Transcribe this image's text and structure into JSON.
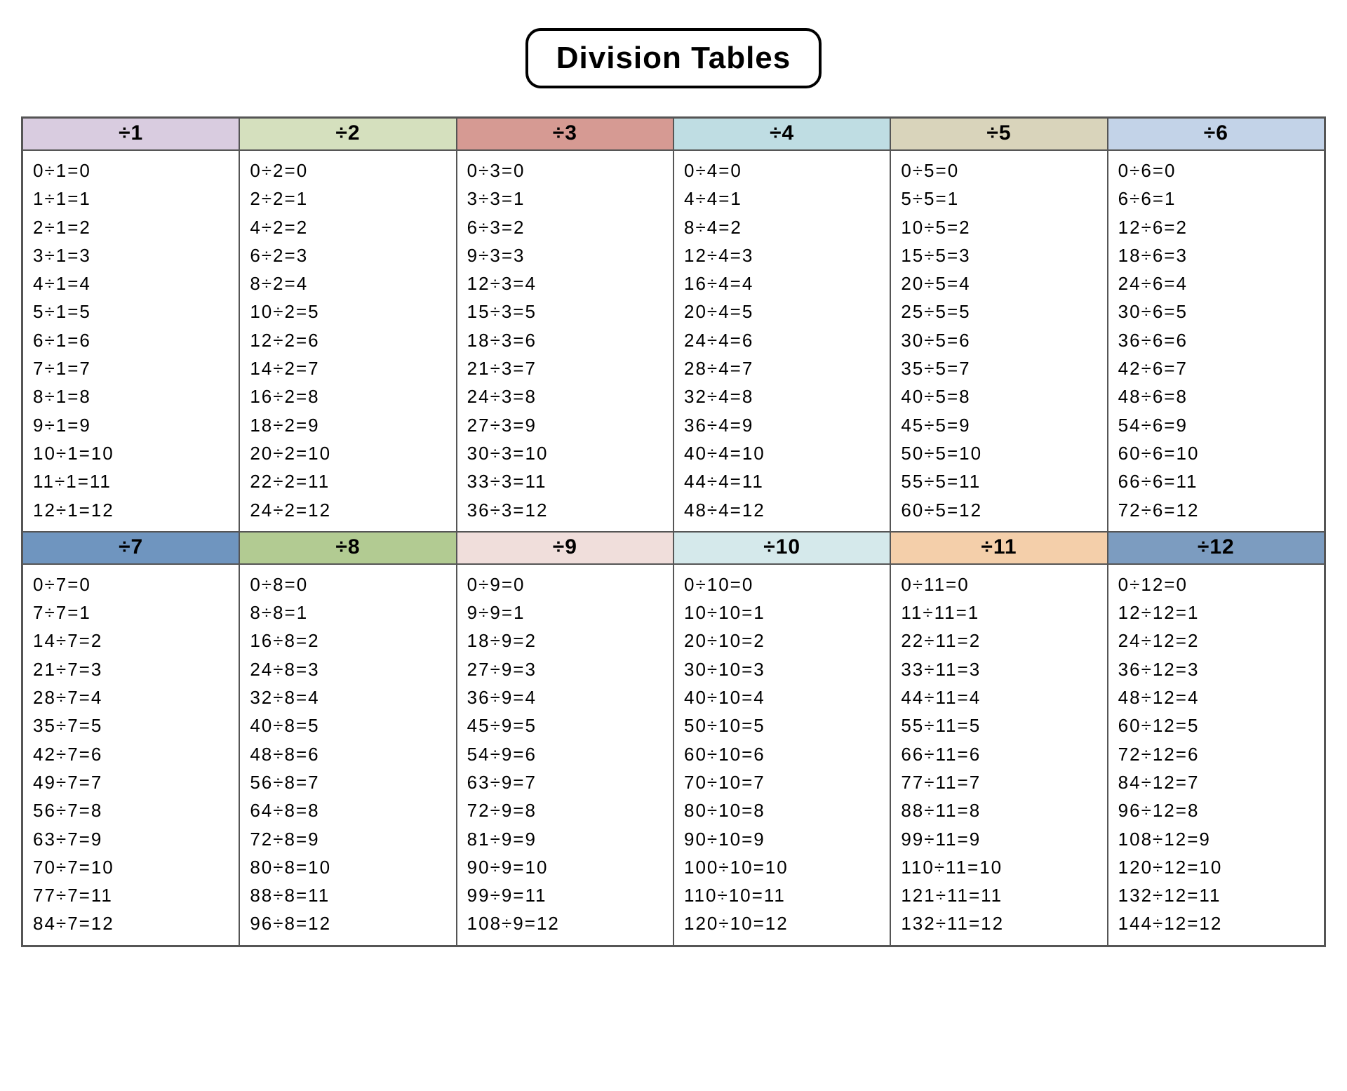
{
  "title": "Division Tables",
  "columns": [
    {
      "header": "÷1",
      "color": "#d9cce0",
      "divisor": 1
    },
    {
      "header": "÷2",
      "color": "#d5e0be",
      "divisor": 2
    },
    {
      "header": "÷3",
      "color": "#d69a93",
      "divisor": 3
    },
    {
      "header": "÷4",
      "color": "#bfdde3",
      "divisor": 4
    },
    {
      "header": "÷5",
      "color": "#d9d4bb",
      "divisor": 5
    },
    {
      "header": "÷6",
      "color": "#c3d3e8",
      "divisor": 6
    },
    {
      "header": "÷7",
      "color": "#6f95bf",
      "divisor": 7
    },
    {
      "header": "÷8",
      "color": "#b2cb92",
      "divisor": 8
    },
    {
      "header": "÷9",
      "color": "#f0dedb",
      "divisor": 9
    },
    {
      "header": "÷10",
      "color": "#d5e9eb",
      "divisor": 10
    },
    {
      "header": "÷11",
      "color": "#f4cfaa",
      "divisor": 11
    },
    {
      "header": "÷12",
      "color": "#7c9cc0",
      "divisor": 12
    }
  ],
  "chart_data": {
    "type": "table",
    "title": "Division Tables",
    "description": "Division facts for divisors 1 through 12, quotients 0 through 12",
    "tables": [
      {
        "divisor": 1,
        "rows": [
          [
            0,
            1,
            0
          ],
          [
            1,
            1,
            1
          ],
          [
            2,
            1,
            2
          ],
          [
            3,
            1,
            3
          ],
          [
            4,
            1,
            4
          ],
          [
            5,
            1,
            5
          ],
          [
            6,
            1,
            6
          ],
          [
            7,
            1,
            7
          ],
          [
            8,
            1,
            8
          ],
          [
            9,
            1,
            9
          ],
          [
            10,
            1,
            10
          ],
          [
            11,
            1,
            11
          ],
          [
            12,
            1,
            12
          ]
        ]
      },
      {
        "divisor": 2,
        "rows": [
          [
            0,
            2,
            0
          ],
          [
            2,
            2,
            1
          ],
          [
            4,
            2,
            2
          ],
          [
            6,
            2,
            3
          ],
          [
            8,
            2,
            4
          ],
          [
            10,
            2,
            5
          ],
          [
            12,
            2,
            6
          ],
          [
            14,
            2,
            7
          ],
          [
            16,
            2,
            8
          ],
          [
            18,
            2,
            9
          ],
          [
            20,
            2,
            10
          ],
          [
            22,
            2,
            11
          ],
          [
            24,
            2,
            12
          ]
        ]
      },
      {
        "divisor": 3,
        "rows": [
          [
            0,
            3,
            0
          ],
          [
            3,
            3,
            1
          ],
          [
            6,
            3,
            2
          ],
          [
            9,
            3,
            3
          ],
          [
            12,
            3,
            4
          ],
          [
            15,
            3,
            5
          ],
          [
            18,
            3,
            6
          ],
          [
            21,
            3,
            7
          ],
          [
            24,
            3,
            8
          ],
          [
            27,
            3,
            9
          ],
          [
            30,
            3,
            10
          ],
          [
            33,
            3,
            11
          ],
          [
            36,
            3,
            12
          ]
        ]
      },
      {
        "divisor": 4,
        "rows": [
          [
            0,
            4,
            0
          ],
          [
            4,
            4,
            1
          ],
          [
            8,
            4,
            2
          ],
          [
            12,
            4,
            3
          ],
          [
            16,
            4,
            4
          ],
          [
            20,
            4,
            5
          ],
          [
            24,
            4,
            6
          ],
          [
            28,
            4,
            7
          ],
          [
            32,
            4,
            8
          ],
          [
            36,
            4,
            9
          ],
          [
            40,
            4,
            10
          ],
          [
            44,
            4,
            11
          ],
          [
            48,
            4,
            12
          ]
        ]
      },
      {
        "divisor": 5,
        "rows": [
          [
            0,
            5,
            0
          ],
          [
            5,
            5,
            1
          ],
          [
            10,
            5,
            2
          ],
          [
            15,
            5,
            3
          ],
          [
            20,
            5,
            4
          ],
          [
            25,
            5,
            5
          ],
          [
            30,
            5,
            6
          ],
          [
            35,
            5,
            7
          ],
          [
            40,
            5,
            8
          ],
          [
            45,
            5,
            9
          ],
          [
            50,
            5,
            10
          ],
          [
            55,
            5,
            11
          ],
          [
            60,
            5,
            12
          ]
        ]
      },
      {
        "divisor": 6,
        "rows": [
          [
            0,
            6,
            0
          ],
          [
            6,
            6,
            1
          ],
          [
            12,
            6,
            2
          ],
          [
            18,
            6,
            3
          ],
          [
            24,
            6,
            4
          ],
          [
            30,
            6,
            5
          ],
          [
            36,
            6,
            6
          ],
          [
            42,
            6,
            7
          ],
          [
            48,
            6,
            8
          ],
          [
            54,
            6,
            9
          ],
          [
            60,
            6,
            10
          ],
          [
            66,
            6,
            11
          ],
          [
            72,
            6,
            12
          ]
        ]
      },
      {
        "divisor": 7,
        "rows": [
          [
            0,
            7,
            0
          ],
          [
            7,
            7,
            1
          ],
          [
            14,
            7,
            2
          ],
          [
            21,
            7,
            3
          ],
          [
            28,
            7,
            4
          ],
          [
            35,
            7,
            5
          ],
          [
            42,
            7,
            6
          ],
          [
            49,
            7,
            7
          ],
          [
            56,
            7,
            8
          ],
          [
            63,
            7,
            9
          ],
          [
            70,
            7,
            10
          ],
          [
            77,
            7,
            11
          ],
          [
            84,
            7,
            12
          ]
        ]
      },
      {
        "divisor": 8,
        "rows": [
          [
            0,
            8,
            0
          ],
          [
            8,
            8,
            1
          ],
          [
            16,
            8,
            2
          ],
          [
            24,
            8,
            3
          ],
          [
            32,
            8,
            4
          ],
          [
            40,
            8,
            5
          ],
          [
            48,
            8,
            6
          ],
          [
            56,
            8,
            7
          ],
          [
            64,
            8,
            8
          ],
          [
            72,
            8,
            9
          ],
          [
            80,
            8,
            10
          ],
          [
            88,
            8,
            11
          ],
          [
            96,
            8,
            12
          ]
        ]
      },
      {
        "divisor": 9,
        "rows": [
          [
            0,
            9,
            0
          ],
          [
            9,
            9,
            1
          ],
          [
            18,
            9,
            2
          ],
          [
            27,
            9,
            3
          ],
          [
            36,
            9,
            4
          ],
          [
            45,
            9,
            5
          ],
          [
            54,
            9,
            6
          ],
          [
            63,
            9,
            7
          ],
          [
            72,
            9,
            8
          ],
          [
            81,
            9,
            9
          ],
          [
            90,
            9,
            10
          ],
          [
            99,
            9,
            11
          ],
          [
            108,
            9,
            12
          ]
        ]
      },
      {
        "divisor": 10,
        "rows": [
          [
            0,
            10,
            0
          ],
          [
            10,
            10,
            1
          ],
          [
            20,
            10,
            2
          ],
          [
            30,
            10,
            3
          ],
          [
            40,
            10,
            4
          ],
          [
            50,
            10,
            5
          ],
          [
            60,
            10,
            6
          ],
          [
            70,
            10,
            7
          ],
          [
            80,
            10,
            8
          ],
          [
            90,
            10,
            9
          ],
          [
            100,
            10,
            10
          ],
          [
            110,
            10,
            11
          ],
          [
            120,
            10,
            12
          ]
        ]
      },
      {
        "divisor": 11,
        "rows": [
          [
            0,
            11,
            0
          ],
          [
            11,
            11,
            1
          ],
          [
            22,
            11,
            2
          ],
          [
            33,
            11,
            3
          ],
          [
            44,
            11,
            4
          ],
          [
            55,
            11,
            5
          ],
          [
            66,
            11,
            6
          ],
          [
            77,
            11,
            7
          ],
          [
            88,
            11,
            8
          ],
          [
            99,
            11,
            9
          ],
          [
            110,
            11,
            10
          ],
          [
            121,
            11,
            11
          ],
          [
            132,
            11,
            12
          ]
        ]
      },
      {
        "divisor": 12,
        "rows": [
          [
            0,
            12,
            0
          ],
          [
            12,
            12,
            1
          ],
          [
            24,
            12,
            2
          ],
          [
            36,
            12,
            3
          ],
          [
            48,
            12,
            4
          ],
          [
            60,
            12,
            5
          ],
          [
            72,
            12,
            6
          ],
          [
            84,
            12,
            7
          ],
          [
            96,
            12,
            8
          ],
          [
            108,
            12,
            9
          ],
          [
            120,
            12,
            10
          ],
          [
            132,
            12,
            11
          ],
          [
            144,
            12,
            12
          ]
        ]
      }
    ]
  }
}
